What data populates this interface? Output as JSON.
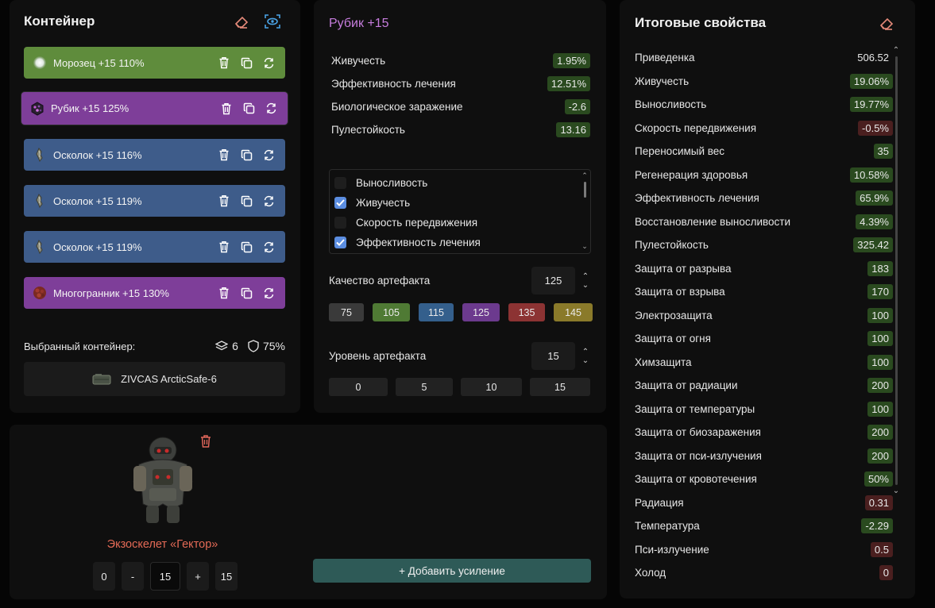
{
  "container": {
    "title": "Контейнер",
    "artifacts": [
      {
        "label": "Морозец +15  110%",
        "color": "#5f8c3c",
        "icon": "frost-artifact-icon"
      },
      {
        "label": "Рубик +15  125%",
        "color": "#7e3e99",
        "icon": "cube-artifact-icon"
      },
      {
        "label": "Осколок +15  116%",
        "color": "#3e5c8a",
        "icon": "shard-artifact-icon"
      },
      {
        "label": "Осколок +15  119%",
        "color": "#3e5c8a",
        "icon": "shard-artifact-icon"
      },
      {
        "label": "Осколок +15  119%",
        "color": "#3e5c8a",
        "icon": "shard-artifact-icon"
      },
      {
        "label": "Многогранник +15  130%",
        "color": "#7e3e99",
        "icon": "polyhedron-artifact-icon"
      }
    ],
    "selected_label": "Выбранный контейнер:",
    "slots": "6",
    "protection": "75%",
    "container_name": "ZIVCAS ArcticSafe-6"
  },
  "detail": {
    "title": "Рубик +15",
    "title_color": "#c77dde",
    "stats": [
      {
        "name": "Живучесть",
        "value": "1.95%",
        "tone": "pos"
      },
      {
        "name": "Эффективность лечения",
        "value": "12.51%",
        "tone": "pos"
      },
      {
        "name": "Биологическое заражение",
        "value": "-2.6",
        "tone": "pos"
      },
      {
        "name": "Пулестойкость",
        "value": "13.16",
        "tone": "pos"
      }
    ],
    "checkboxes": [
      {
        "label": "Выносливость",
        "checked": false
      },
      {
        "label": "Живучесть",
        "checked": true
      },
      {
        "label": "Скорость передвижения",
        "checked": false
      },
      {
        "label": "Эффективность лечения",
        "checked": true
      }
    ],
    "quality_label": "Качество артефакта",
    "quality_value": "125",
    "quality_presets": [
      {
        "value": "75",
        "color": "#3a3a3a"
      },
      {
        "value": "105",
        "color": "#4f7a34"
      },
      {
        "value": "115",
        "color": "#345f8c"
      },
      {
        "value": "125",
        "color": "#6c3a8e"
      },
      {
        "value": "135",
        "color": "#8c3333"
      },
      {
        "value": "145",
        "color": "#8a7a2a"
      }
    ],
    "level_label": "Уровень артефакта",
    "level_value": "15",
    "level_presets": [
      "0",
      "5",
      "10",
      "15"
    ]
  },
  "summary": {
    "title": "Итоговые свойства",
    "rows": [
      {
        "name": "Приведенка",
        "value": "506.52",
        "tone": "plain"
      },
      {
        "name": "Живучесть",
        "value": "19.06%",
        "tone": "pos"
      },
      {
        "name": "Выносливость",
        "value": "19.77%",
        "tone": "pos"
      },
      {
        "name": "Скорость передвижения",
        "value": "-0.5%",
        "tone": "neg"
      },
      {
        "name": "Переносимый вес",
        "value": "35",
        "tone": "pos"
      },
      {
        "name": "Регенерация здоровья",
        "value": "10.58%",
        "tone": "pos"
      },
      {
        "name": "Эффективность лечения",
        "value": "65.9%",
        "tone": "pos"
      },
      {
        "name": "Восстановление выносливости",
        "value": "4.39%",
        "tone": "pos"
      },
      {
        "name": "Пулестойкость",
        "value": "325.42",
        "tone": "pos"
      },
      {
        "name": "Защита от разрыва",
        "value": "183",
        "tone": "pos"
      },
      {
        "name": "Защита от взрыва",
        "value": "170",
        "tone": "pos"
      },
      {
        "name": "Электрозащита",
        "value": "100",
        "tone": "pos"
      },
      {
        "name": "Защита от огня",
        "value": "100",
        "tone": "pos"
      },
      {
        "name": "Химзащита",
        "value": "100",
        "tone": "pos"
      },
      {
        "name": "Защита от радиации",
        "value": "200",
        "tone": "pos"
      },
      {
        "name": "Защита от температуры",
        "value": "100",
        "tone": "pos"
      },
      {
        "name": "Защита от биозаражения",
        "value": "200",
        "tone": "pos"
      },
      {
        "name": "Защита от пси-излучения",
        "value": "200",
        "tone": "pos"
      },
      {
        "name": "Защита от кровотечения",
        "value": "50%",
        "tone": "pos"
      },
      {
        "name": "Радиация",
        "value": "0.31",
        "tone": "neg"
      },
      {
        "name": "Температура",
        "value": "-2.29",
        "tone": "pos"
      },
      {
        "name": "Пси-излучение",
        "value": "0.5",
        "tone": "neg"
      },
      {
        "name": "Холод",
        "value": "0",
        "tone": "neg"
      }
    ]
  },
  "armor": {
    "name": "Экзоскелет «Гектор»",
    "min": "0",
    "minus": "-",
    "level": "15",
    "plus": "+",
    "max": "15",
    "add_label": "+ Добавить усиление"
  }
}
